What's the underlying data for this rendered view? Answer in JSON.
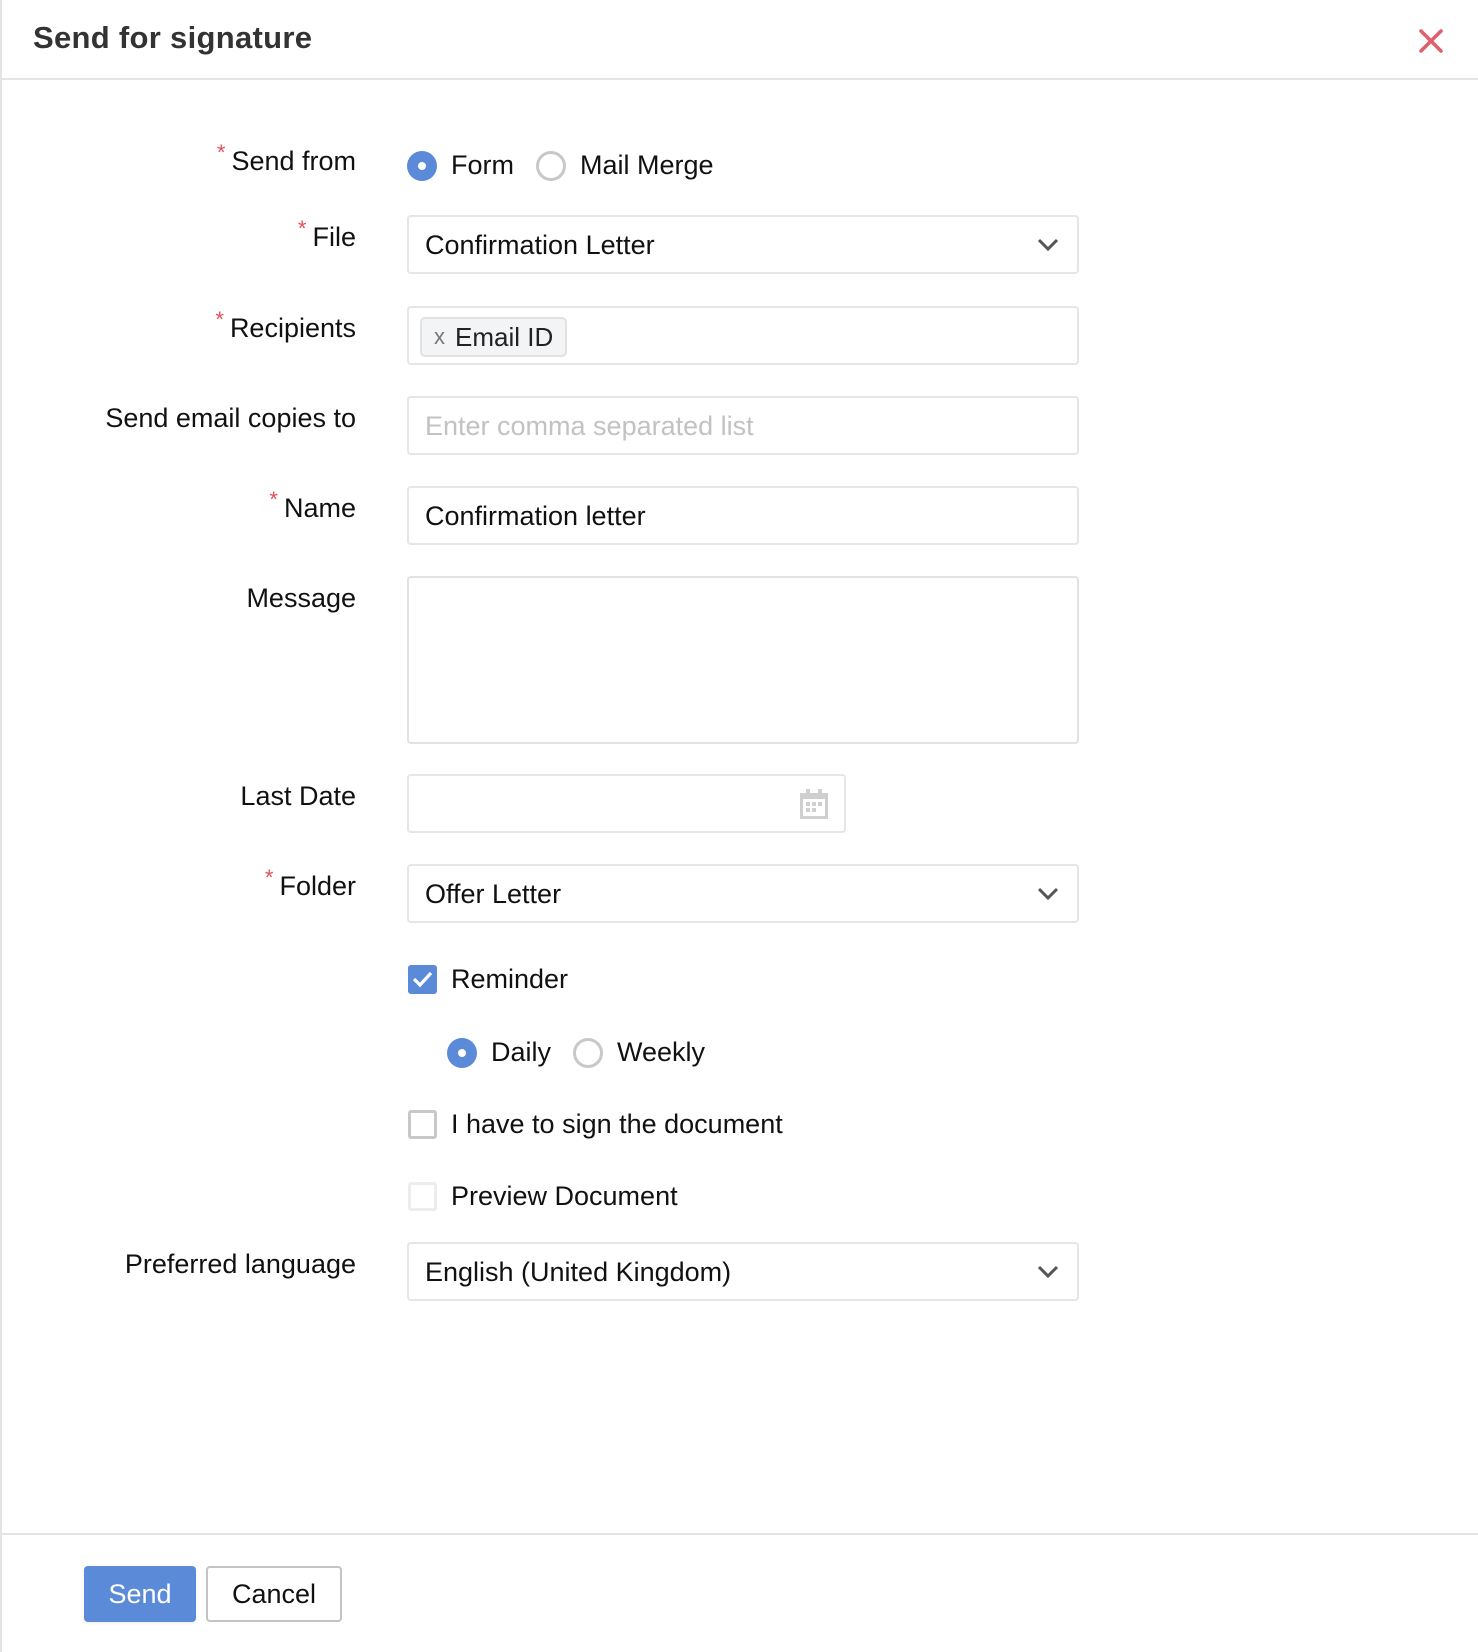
{
  "dialog": {
    "title": "Send for signature",
    "close_icon": "close-icon"
  },
  "form": {
    "send_from": {
      "label": "Send from",
      "required": true,
      "options": [
        {
          "label": "Form",
          "selected": true
        },
        {
          "label": "Mail Merge",
          "selected": false
        }
      ]
    },
    "file": {
      "label": "File",
      "required": true,
      "value": "Confirmation Letter",
      "icon": "chevron-down-icon"
    },
    "recipients": {
      "label": "Recipients",
      "required": true,
      "chips": [
        {
          "remove_glyph": "x",
          "label": "Email ID"
        }
      ]
    },
    "copies": {
      "label": "Send email copies to",
      "value": "",
      "placeholder": "Enter comma separated list"
    },
    "name": {
      "label": "Name",
      "required": true,
      "value": "Confirmation letter"
    },
    "message": {
      "label": "Message",
      "value": ""
    },
    "last_date": {
      "label": "Last Date",
      "value": "",
      "icon": "calendar-icon"
    },
    "folder": {
      "label": "Folder",
      "required": true,
      "value": "Offer Letter",
      "icon": "chevron-down-icon"
    },
    "reminder": {
      "label": "Reminder",
      "checked": true,
      "frequency": [
        {
          "label": "Daily",
          "selected": true
        },
        {
          "label": "Weekly",
          "selected": false
        }
      ]
    },
    "i_sign": {
      "label": "I have to sign the document",
      "checked": false
    },
    "preview": {
      "label": "Preview Document",
      "checked": false,
      "disabled": true
    },
    "language": {
      "label": "Preferred language",
      "value": "English (United Kingdom)",
      "icon": "chevron-down-icon"
    },
    "required_marker": "*"
  },
  "footer": {
    "send_label": "Send",
    "cancel_label": "Cancel"
  },
  "colors": {
    "accent": "#5a8ad8",
    "required": "#e0505a",
    "close": "#e0606e"
  }
}
